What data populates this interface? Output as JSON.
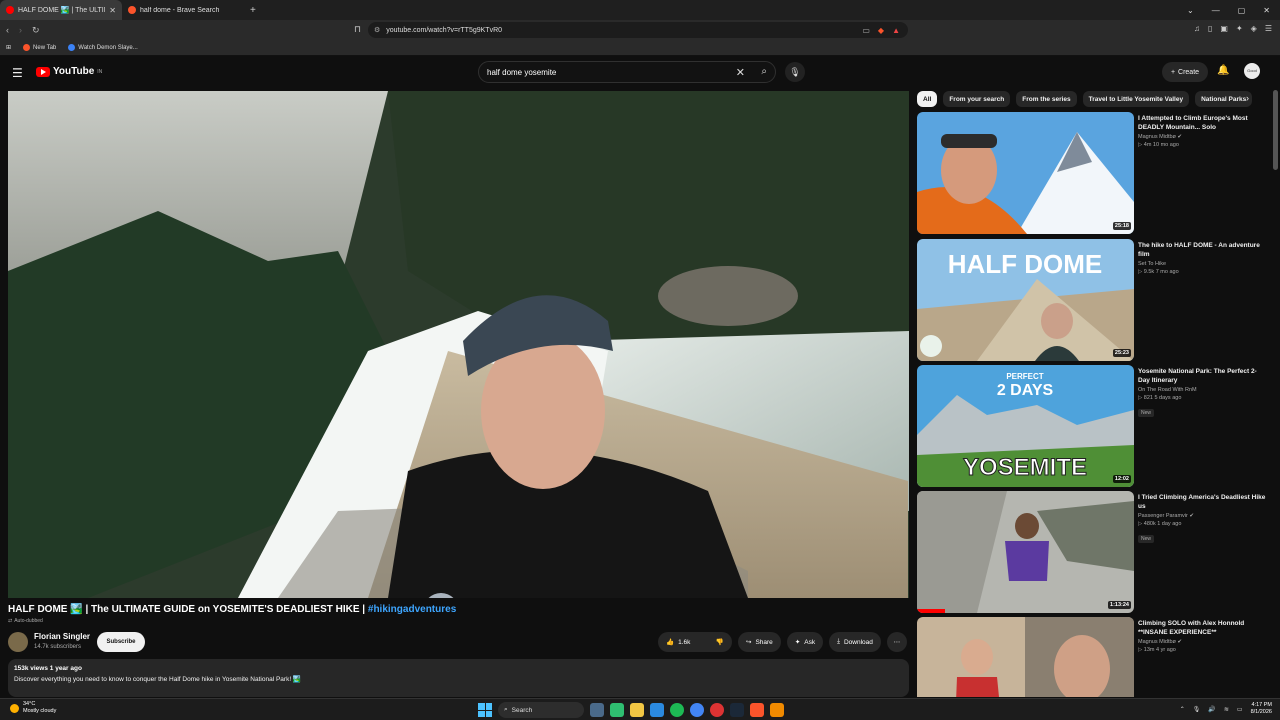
{
  "browser": {
    "tabs": [
      {
        "title": "HALF DOME 🏞️ | The ULTIMATE",
        "active": true
      },
      {
        "title": "half dome - Brave Search",
        "active": false
      }
    ],
    "url": "youtube.com/watch?v=rTT5g9KTvR0",
    "bookmarks": [
      "New Tab",
      "Watch Demon Slaye..."
    ]
  },
  "youtube": {
    "logo_text": "YouTube",
    "logo_region": "IN",
    "search_value": "half dome yosemite",
    "create_label": "Create",
    "avatar_text": "Good"
  },
  "video": {
    "title": "HALF DOME 🏞️ | The ULTIMATE GUIDE on YOSEMITE'S DEADLIEST HIKE |",
    "hashtag": "#hikingadventures",
    "auto_dubbed": "Auto-dubbed",
    "channel": "Florian Singler",
    "subscribers": "14.7k subscribers",
    "subscribe_label": "Subscribe",
    "likes": "1.6k",
    "share_label": "Share",
    "ask_label": "Ask",
    "download_label": "Download",
    "stats": "153k views  1 year ago",
    "description": "Discover everything you need to know to conquer the Half Dome hike in Yosemite National Park! 🏞️"
  },
  "chips": [
    "All",
    "From your search",
    "From the series",
    "Travel to Little Yosemite Valley",
    "National Parks"
  ],
  "recommendations": [
    {
      "title": "I Attempted to Climb Europe's Most DEADLY Mountain... Solo",
      "channel": "Magnus Midtbø ✔",
      "views": "4m  10 mo ago",
      "duration": "25:18",
      "badge": "",
      "thumb_text": ""
    },
    {
      "title": "The hike to HALF DOME - An adventure film",
      "channel": "Set To Hike",
      "views": "9.5k  7 mo ago",
      "duration": "25:23",
      "badge": "",
      "thumb_text": "HALF DOME"
    },
    {
      "title": "Yosemite National Park: The Perfect 2-Day Itinerary",
      "channel": "On The Road With RnM",
      "views": "821  5 days ago",
      "duration": "12:02",
      "badge": "New",
      "thumb_text": "YOSEMITE",
      "thumb_top_small": "PERFECT",
      "thumb_top_big": "2 DAYS"
    },
    {
      "title": "I Tried Climbing America's Deadliest Hike us",
      "channel": "Passenger Paramvir ✔",
      "views": "480k  1 day ago",
      "duration": "1:13:24",
      "badge": "New",
      "thumb_text": ""
    },
    {
      "title": "Climbing SOLO with Alex Honnold **INSANE EXPERIENCE**",
      "channel": "Magnus Midtbø ✔",
      "views": "13m  4 yr ago",
      "duration": "",
      "badge": "",
      "thumb_text": ""
    }
  ],
  "taskbar": {
    "temp": "34°C",
    "weather": "Mostly cloudy",
    "search_label": "Search",
    "time": "4:17 PM",
    "date": "8/1/2026"
  },
  "colors": {
    "accent_red": "#ff0000",
    "link_blue": "#3ea6ff",
    "bg": "#0f0f0f"
  }
}
